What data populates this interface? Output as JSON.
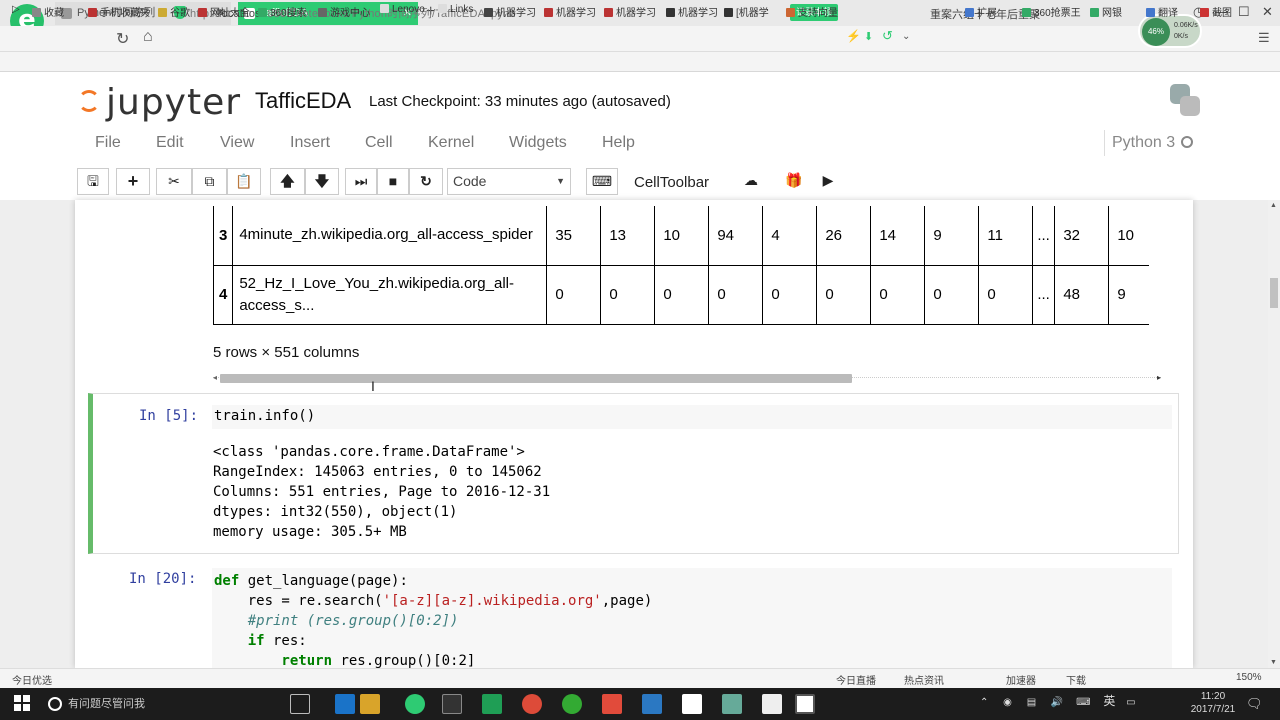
{
  "browser": {
    "tabs": [
      {
        "label": "Python时间序列"
      },
      {
        "label": "TafficEDA"
      }
    ],
    "new_tab": "+",
    "url_prefix": "http://",
    "url_host": "localhost",
    "url_rest": ":8888/notebooks/Python时间序列/TafficEDA.ipynb",
    "ext_badge": "记录本领",
    "news_text": "重案六组十七年后重聚",
    "speed": {
      "percent": "46%",
      "up": "0.06K/s",
      "down": "0K/s"
    }
  },
  "bookmarks": [
    "收藏",
    "手机收藏夹",
    "谷歌",
    "网址大全",
    "360搜索",
    "游戏中心",
    "Lenovo",
    "Links",
    "机器学习",
    "机器学习",
    "机器学习",
    "机器学习",
    "[机器学",
    "支持向量"
  ],
  "bookmarks_right": [
    "扩展",
    "360抢票王",
    "网银",
    "翻译",
    "截图"
  ],
  "jupyter": {
    "logo_text": "jupyter",
    "notebook_name": "TafficEDA",
    "checkpoint": "Last Checkpoint: 33 minutes ago (autosaved)",
    "menu": [
      "File",
      "Edit",
      "View",
      "Insert",
      "Cell",
      "Kernel",
      "Widgets",
      "Help"
    ],
    "kernel": "Python 3",
    "cell_type": "Code",
    "cell_toolbar": "CellToolbar"
  },
  "dataframe": {
    "rows": [
      {
        "idx": "3",
        "page": "4minute_zh.wikipedia.org_all-access_spider",
        "values": [
          "35",
          "13",
          "10",
          "94",
          "4",
          "26",
          "14",
          "9",
          "11",
          "...",
          "32",
          "10"
        ]
      },
      {
        "idx": "4",
        "page": "52_Hz_I_Love_You_zh.wikipedia.org_all-access_s...",
        "values": [
          "0",
          "0",
          "0",
          "0",
          "0",
          "0",
          "0",
          "0",
          "0",
          "...",
          "48",
          "9"
        ]
      }
    ],
    "shape": "5 rows × 551 columns"
  },
  "cell5": {
    "prompt": "In [5]:",
    "code": "train.info()",
    "output": [
      "<class 'pandas.core.frame.DataFrame'>",
      "RangeIndex: 145063 entries, 0 to 145062",
      "Columns: 551 entries, Page to 2016-12-31",
      "dtypes: int32(550), object(1)",
      "memory usage: 305.5+ MB"
    ]
  },
  "cell20": {
    "prompt": "In [20]:",
    "lines": [
      {
        "kw": "def",
        "rest": " get_language(page):"
      },
      {
        "pre": "    res = re.search(",
        "str": "'[a-z][a-z].wikipedia.org'",
        "post": ",page)"
      },
      {
        "comment": "    #print (res.group()[0:2])"
      },
      {
        "kw": "    if",
        "rest": " res:"
      },
      {
        "kw": "        return",
        "rest": " res.group()[0:2]"
      }
    ]
  },
  "statusbar": {
    "left": "今日优选",
    "items": [
      "今日直播",
      "热点资讯",
      "加速器",
      "下载",
      "150%"
    ]
  },
  "taskbar": {
    "search": "有问题尽管问我",
    "tray_lang": "英",
    "time": "11:20",
    "date": "2017/7/21"
  }
}
